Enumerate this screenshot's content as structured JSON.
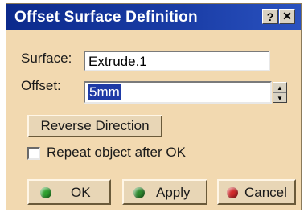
{
  "window": {
    "title": "Offset Surface Definition",
    "help_glyph": "?",
    "close_glyph": "✕"
  },
  "form": {
    "surface_label": "Surface:",
    "surface_value": "Extrude.1",
    "offset_label": "Offset:",
    "offset_value": "5mm",
    "spin_up": "▲",
    "spin_down": "▼",
    "reverse_label": "Reverse Direction",
    "repeat_label": "Repeat object after OK",
    "repeat_checked": false
  },
  "buttons": {
    "ok_label": "OK",
    "apply_label": "Apply",
    "cancel_label": "Cancel",
    "ok_color": "#2ea02e",
    "apply_color": "#2e8a2e",
    "cancel_color": "#d02a2a"
  },
  "colors": {
    "title_bar": "#0c2a8c",
    "dialog_bg": "#f2d9b0",
    "selection": "#1e3aa6"
  }
}
